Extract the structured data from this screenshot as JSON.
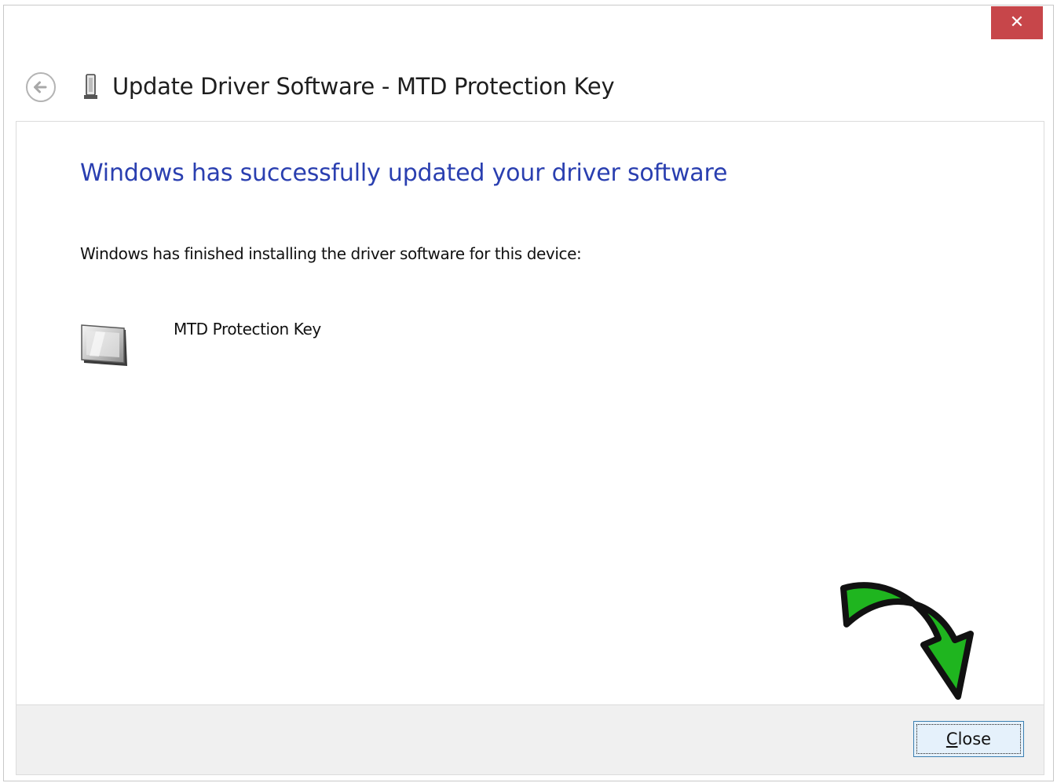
{
  "window": {
    "title": "Update Driver Software - MTD Protection Key",
    "close_glyph": "✕",
    "back_icon": "back-arrow-icon",
    "title_icon": "usb-device-icon",
    "close_button_color": "#c7464a"
  },
  "content": {
    "headline": "Windows has successfully updated your driver software",
    "headline_color": "#2a3fb0",
    "description": "Windows has finished installing the driver software for this device:",
    "device": {
      "name": "MTD Protection Key",
      "icon": "device-generic-icon"
    }
  },
  "annotation": {
    "icon": "green-curved-arrow-icon",
    "color": "#1fb51f"
  },
  "footer": {
    "close_button": {
      "mnemonic": "C",
      "rest": "lose"
    }
  }
}
